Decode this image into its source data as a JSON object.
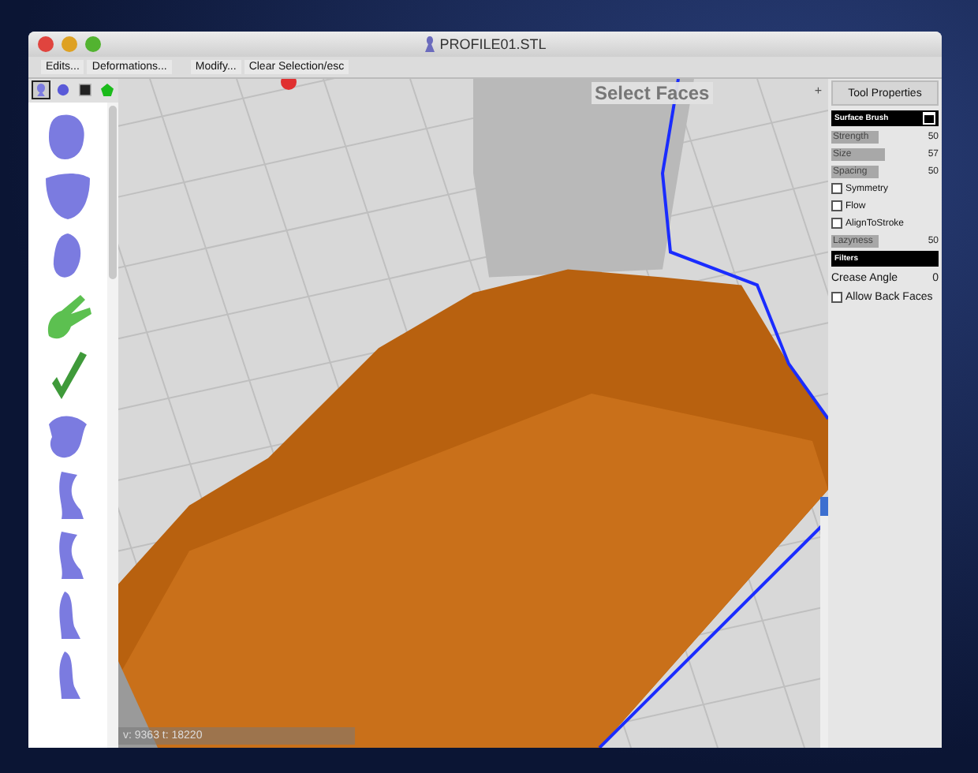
{
  "window": {
    "title": "PROFILE01.STL"
  },
  "toolbar": [
    "Edits...",
    "Deformations...",
    "Modify...",
    "Clear Selection/esc"
  ],
  "library_tabs": [
    {
      "kind": "head",
      "selected": true
    },
    {
      "kind": "sphere",
      "selected": false
    },
    {
      "kind": "square",
      "selected": false
    },
    {
      "kind": "pentagon",
      "selected": false
    }
  ],
  "library": [
    {
      "kind": "head",
      "color": "#7b7be0"
    },
    {
      "kind": "face",
      "color": "#7b7be0"
    },
    {
      "kind": "ear",
      "color": "#7b7be0"
    },
    {
      "kind": "hand",
      "color": "#5cc050"
    },
    {
      "kind": "check",
      "color": "#3f9a3a"
    },
    {
      "kind": "torso",
      "color": "#7b7be0"
    },
    {
      "kind": "leg",
      "color": "#7b7be0"
    },
    {
      "kind": "leg",
      "color": "#7b7be0"
    },
    {
      "kind": "foot",
      "color": "#7b7be0"
    },
    {
      "kind": "foot",
      "color": "#7b7be0"
    }
  ],
  "viewport": {
    "mode_label": "Select Faces",
    "expand_button": "+",
    "status": "v: 9363  t: 18220"
  },
  "tool_properties": {
    "tab": "Tool Properties",
    "section": "Surface Brush",
    "rows": [
      {
        "kind": "slider",
        "label": "Strength",
        "level": 0.5,
        "reading": "50"
      },
      {
        "kind": "slider",
        "label": "Size",
        "level": 0.57,
        "reading": "57"
      },
      {
        "kind": "slider",
        "label": "Spacing",
        "level": 0.5,
        "reading": "50"
      },
      {
        "kind": "checkbox",
        "label": "Symmetry",
        "checked": false
      },
      {
        "kind": "checkbox",
        "label": "Flow",
        "checked": false
      },
      {
        "kind": "checkbox",
        "label": "AlignToStroke",
        "checked": false
      },
      {
        "kind": "slider",
        "label": "Lazyness",
        "level": 0.5,
        "reading": "50"
      }
    ],
    "filters_section": "Filters",
    "filters": [
      {
        "kind": "value",
        "label": "Crease Angle",
        "reading": "0"
      },
      {
        "kind": "checkbox",
        "label": "Allow Back Faces",
        "checked": false
      }
    ]
  }
}
